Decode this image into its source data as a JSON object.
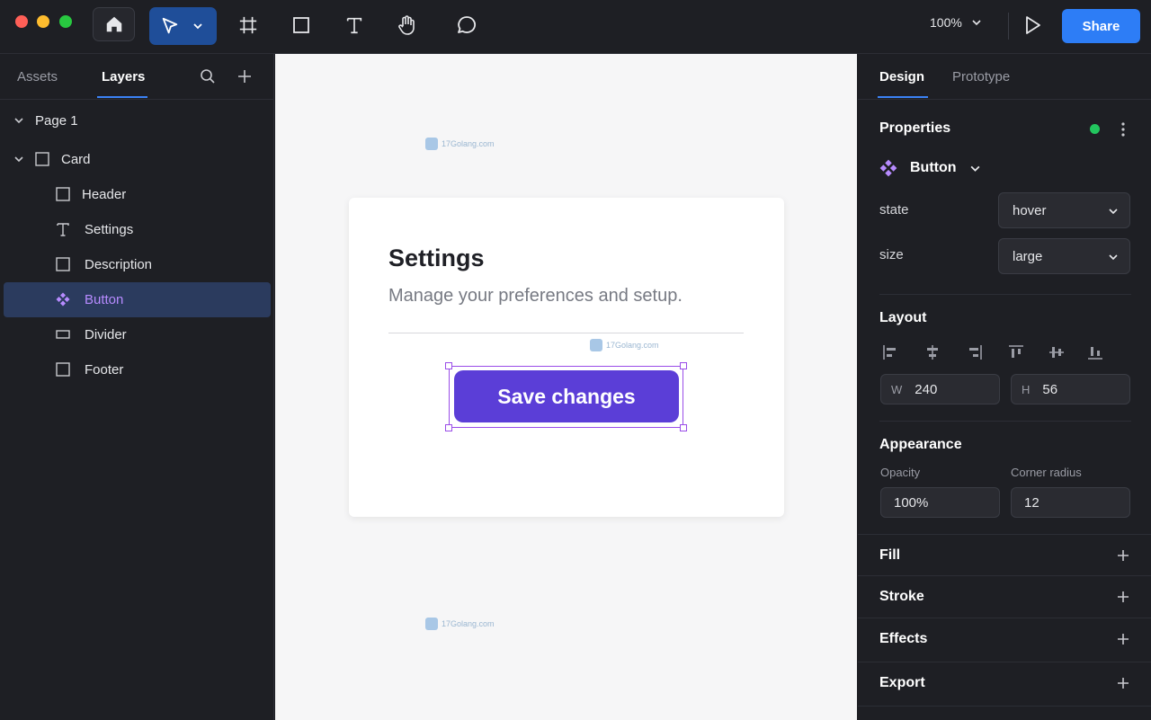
{
  "toolbar": {
    "zoom": "100%",
    "share_label": "Share"
  },
  "left_panel": {
    "tabs": [
      {
        "label": "Assets",
        "active": false
      },
      {
        "label": "Layers",
        "active": true
      }
    ],
    "page": {
      "label": "Page 1"
    },
    "card": {
      "label": "Card"
    },
    "layers": [
      {
        "label": "Header",
        "icon": "frame-icon",
        "selected": false
      },
      {
        "label": "Settings",
        "icon": "text-icon",
        "selected": false
      },
      {
        "label": "Description",
        "icon": "frame-icon",
        "selected": false
      },
      {
        "label": "Button",
        "icon": "component-icon",
        "selected": true
      },
      {
        "label": "Divider",
        "icon": "rectangle-icon",
        "selected": false
      },
      {
        "label": "Footer",
        "icon": "frame-icon",
        "selected": false
      }
    ]
  },
  "canvas": {
    "card_title": "Settings",
    "card_description": "Manage your preferences and setup.",
    "button_label": "Save changes",
    "watermark": "17Golang.com"
  },
  "right_panel": {
    "tabs": [
      {
        "label": "Design",
        "active": true
      },
      {
        "label": "Prototype",
        "active": false
      }
    ],
    "properties": {
      "title": "Properties",
      "component_name": "Button",
      "state_label": "state",
      "state_value": "hover",
      "size_label": "size",
      "size_value": "large"
    },
    "layout": {
      "title": "Layout",
      "w_label": "W",
      "w_value": "240",
      "h_label": "H",
      "h_value": "56"
    },
    "appearance": {
      "title": "Appearance",
      "opacity_label": "Opacity",
      "opacity_value": "100%",
      "radius_label": "Corner radius",
      "radius_value": "12"
    },
    "sections": {
      "fill": "Fill",
      "stroke": "Stroke",
      "effects": "Effects",
      "export": "Export"
    }
  },
  "colors": {
    "accent": "#2d7df6",
    "button": "#5b3ed7",
    "selection": "#9a4ce8",
    "component": "#b78bff",
    "status": "#22c55e"
  }
}
